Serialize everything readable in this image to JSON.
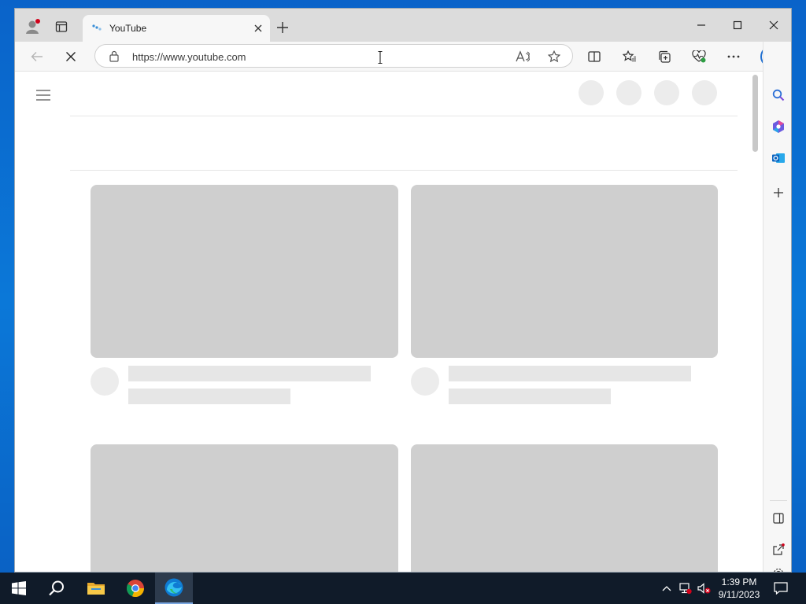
{
  "browser": {
    "tab": {
      "title": "YouTube"
    },
    "address_bar": {
      "url": "https://www.youtube.com"
    }
  },
  "taskbar": {
    "time": "1:39 PM",
    "date": "9/11/2023"
  },
  "colors": {
    "desktop": "#0a6fd0",
    "skeleton": "#cfcfcf",
    "skeleton_light": "#ececec",
    "edge_accent": "#0f7bd3",
    "taskbar": "#101b29"
  }
}
